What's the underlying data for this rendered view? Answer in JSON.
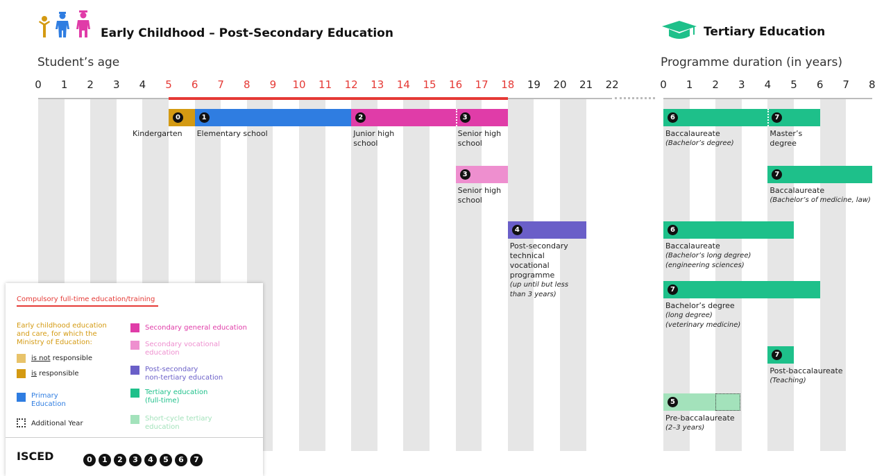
{
  "header": {
    "left_title": "Early Childhood – Post-Secondary Education",
    "right_title": "Tertiary Education",
    "left_subtitle": "Student’s age",
    "right_subtitle": "Programme duration (in years)"
  },
  "axis_left": {
    "ticks": [
      "0",
      "1",
      "2",
      "3",
      "4",
      "5",
      "6",
      "7",
      "8",
      "9",
      "10",
      "11",
      "12",
      "13",
      "14",
      "15",
      "16",
      "17",
      "18",
      "19",
      "20",
      "21",
      "22"
    ],
    "highlight_range": [
      5,
      18
    ],
    "highlight_color": "#e53935"
  },
  "axis_right": {
    "ticks": [
      "0",
      "1",
      "2",
      "3",
      "4",
      "5",
      "6",
      "7",
      "8"
    ]
  },
  "colors": {
    "ecec_not": "#e8c36a",
    "ecec_is": "#d49a12",
    "primary": "#2f7de1",
    "secondary_general": "#e03ca8",
    "secondary_vocational": "#ee8fcf",
    "post_secondary": "#6a5fc8",
    "tertiary": "#1ec08a",
    "short_cycle": "#a3e2bb",
    "compulsory": "#e53935"
  },
  "left_bars": [
    {
      "id": "kindergarten",
      "start": 5,
      "end": 6,
      "color": "#d49a12",
      "row": 0,
      "isced": "0",
      "label": [
        "Kindergarten"
      ]
    },
    {
      "id": "elementary",
      "start": 6,
      "end": 12,
      "color": "#2f7de1",
      "row": 0,
      "isced": "1",
      "label": [
        "Elementary school"
      ]
    },
    {
      "id": "junior-high",
      "start": 12,
      "end": 16,
      "color": "#e03ca8",
      "row": 0,
      "isced": "2",
      "label": [
        "Junior high",
        "school"
      ]
    },
    {
      "id": "senior-high-general",
      "start": 16,
      "end": 18,
      "color": "#e03ca8",
      "row": 0,
      "isced": "3",
      "label": [
        "Senior high",
        "school"
      ]
    },
    {
      "id": "senior-high-vocational",
      "start": 16,
      "end": 18,
      "color": "#ee8fcf",
      "row": 1,
      "isced": "3",
      "label": [
        "Senior high",
        "school"
      ]
    },
    {
      "id": "post-secondary",
      "start": 18,
      "end": 21,
      "color": "#6a5fc8",
      "row": 2,
      "isced": "4",
      "label": [
        "Post-secondary",
        "technical",
        "vocational",
        "programme"
      ],
      "note": [
        "(up until but less",
        "than 3 years)"
      ]
    }
  ],
  "right_bars": [
    {
      "id": "baccalaureate",
      "start": 0,
      "end": 4,
      "color": "#1ec08a",
      "row": 0,
      "isced": "6",
      "label": [
        "Baccalaureate"
      ],
      "note": [
        "(Bachelor’s degree)"
      ]
    },
    {
      "id": "masters",
      "start": 4,
      "end": 6,
      "color": "#1ec08a",
      "row": 0,
      "isced": "7",
      "label": [
        "Master’s",
        "degree"
      ]
    },
    {
      "id": "bacc-medicine",
      "start": 4,
      "end": 8,
      "color": "#1ec08a",
      "row": 1,
      "isced": "7",
      "label": [
        "Baccalaureate"
      ],
      "note": [
        "(Bachelor’s of medicine, law)"
      ]
    },
    {
      "id": "bacc-engineering",
      "start": 0,
      "end": 5,
      "color": "#1ec08a",
      "row": 2,
      "isced": "6",
      "label": [
        "Baccalaureate"
      ],
      "note": [
        "(Bachelor’s long degree)",
        "(engineering sciences)"
      ]
    },
    {
      "id": "bachelor-vet",
      "start": 0,
      "end": 6,
      "color": "#1ec08a",
      "row": 3,
      "isced": "7",
      "label": [
        "Bachelor’s degree"
      ],
      "note": [
        "(long degree)",
        "(veterinary medicine)"
      ]
    },
    {
      "id": "post-bacc",
      "start": 4,
      "end": 5,
      "color": "#1ec08a",
      "row": 4,
      "isced": "7",
      "label": [
        "Post-baccalaureate"
      ],
      "note": [
        "(Teaching)"
      ]
    },
    {
      "id": "pre-bacc",
      "start": 0,
      "end": 2,
      "extra_end": 3,
      "color": "#a3e2bb",
      "row": 5,
      "isced": "5",
      "label": [
        "Pre-baccalaureate"
      ],
      "note": [
        "(2–3 years)"
      ]
    }
  ],
  "legend": {
    "compulsory": "Compulsory full-time education/training",
    "ecec_heading": [
      "Early childhood education",
      "and care, for which the",
      "Ministry of Education:"
    ],
    "not_underlined": "is not",
    "not_rest": " responsible",
    "is_underlined": "is",
    "is_rest": " responsible",
    "primary": [
      "Primary",
      "Education"
    ],
    "additional": "Additional Year",
    "secondary_general": "Secondary general education",
    "secondary_vocational": [
      "Secondary vocational",
      "education"
    ],
    "post_secondary": [
      "Post-secondary",
      "non-tertiary education"
    ],
    "tertiary": [
      "Tertiary education",
      "(full-time)"
    ],
    "short_cycle": [
      "Short-cycle tertiary",
      "education"
    ],
    "isced_label": "ISCED",
    "isced_levels": [
      "0",
      "1",
      "2",
      "3",
      "4",
      "5",
      "6",
      "7"
    ]
  }
}
